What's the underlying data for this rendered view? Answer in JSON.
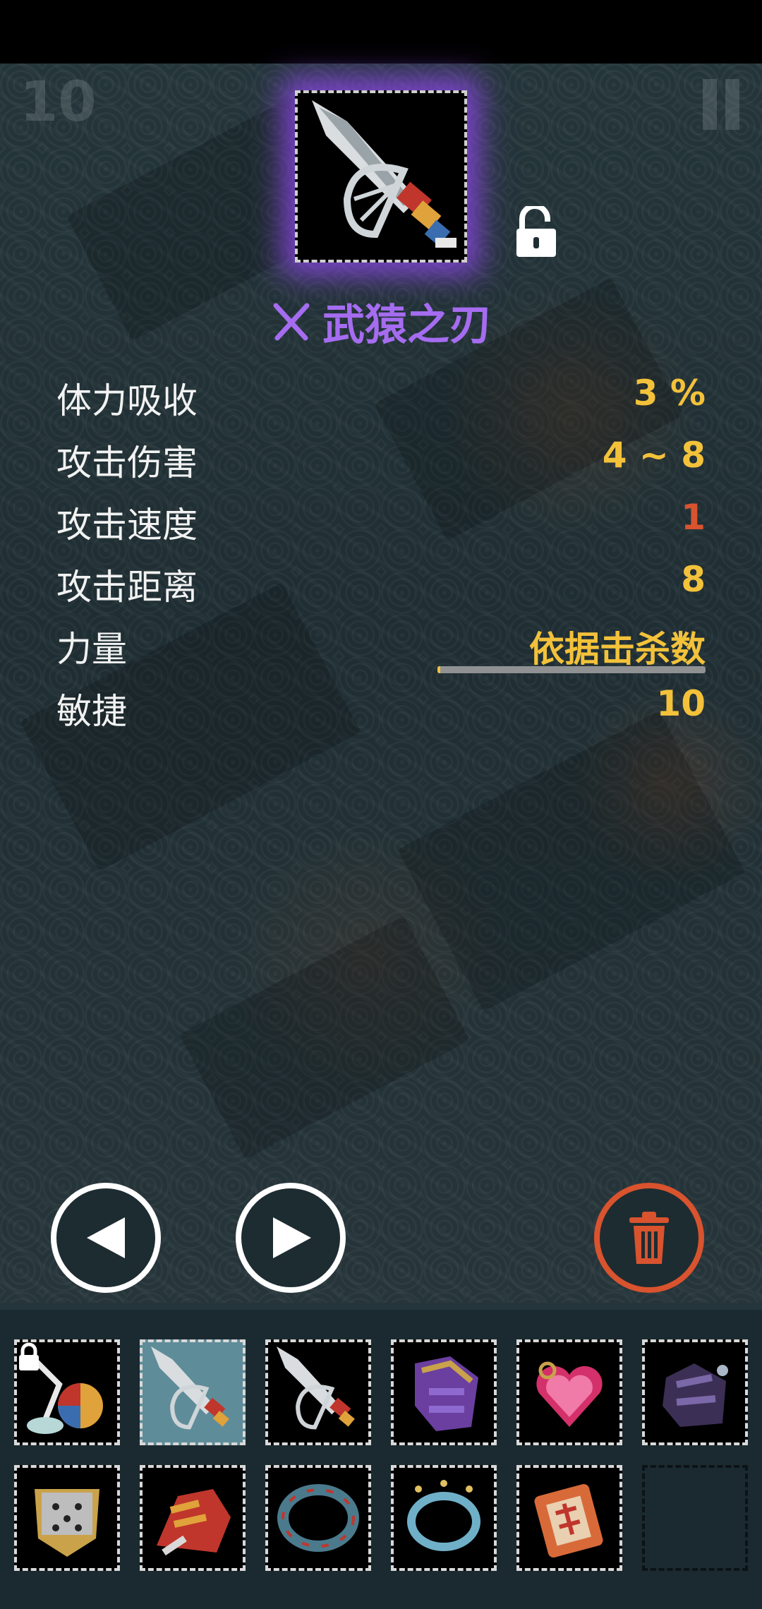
{
  "hud": {
    "level": "10"
  },
  "item": {
    "name": "武猿之刃",
    "rarity_color": "#a56cf0",
    "icon": "axe-blade-icon",
    "lock_state": "unlocked"
  },
  "stats": [
    {
      "label": "体力吸收",
      "value": "3 %",
      "color": "#f3c23a"
    },
    {
      "label": "攻击伤害",
      "value": "4 ~ 8",
      "color": "#f3c23a"
    },
    {
      "label": "攻击速度",
      "value": "1",
      "color": "#d8532e"
    },
    {
      "label": "攻击距离",
      "value": "8",
      "color": "#f3c23a"
    },
    {
      "label": "力量",
      "value": "依据击杀数",
      "color": "#f3c23a",
      "progress": 0.01
    },
    {
      "label": "敏捷",
      "value": "10",
      "color": "#f3c23a"
    }
  ],
  "buttons": {
    "prev": "previous-arrow-icon",
    "next": "next-arrow-icon",
    "delete": "trash-icon"
  },
  "inventory": [
    {
      "icon": "banner-axe-icon",
      "state": "locked"
    },
    {
      "icon": "axe-blade-icon",
      "state": "selected"
    },
    {
      "icon": "axe-blade-icon",
      "state": "normal"
    },
    {
      "icon": "purple-armor-icon",
      "state": "normal"
    },
    {
      "icon": "heart-amulet-icon",
      "state": "normal"
    },
    {
      "icon": "dark-gauntlet-icon",
      "state": "normal"
    },
    {
      "icon": "stone-mask-icon",
      "state": "normal"
    },
    {
      "icon": "fire-glove-icon",
      "state": "normal"
    },
    {
      "icon": "dark-ring-icon",
      "state": "normal"
    },
    {
      "icon": "spiked-ring-icon",
      "state": "normal"
    },
    {
      "icon": "talisman-tag-icon",
      "state": "normal"
    },
    {
      "icon": "empty-slot",
      "state": "empty"
    }
  ]
}
